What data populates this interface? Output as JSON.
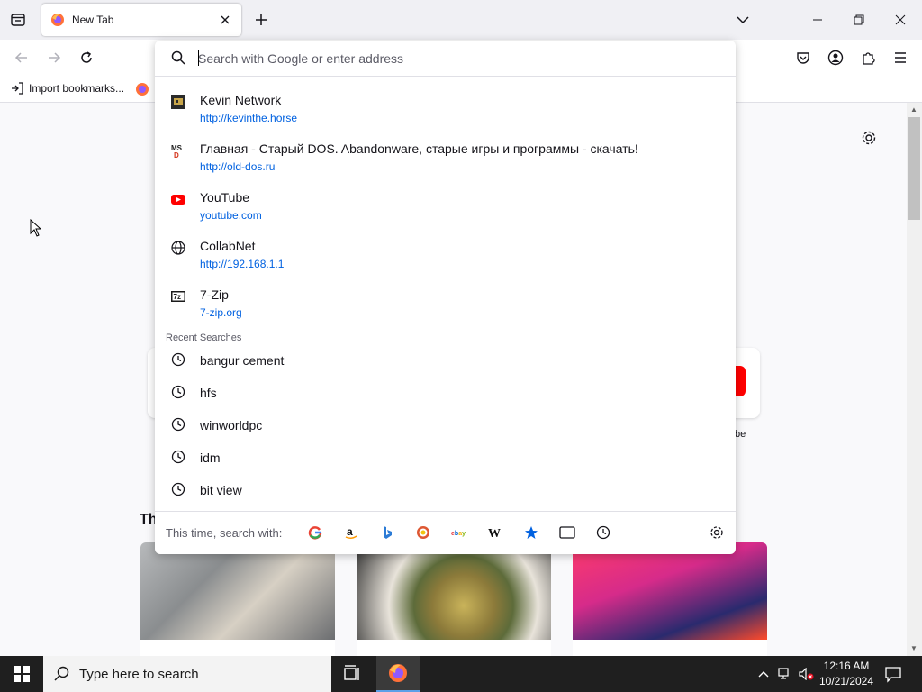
{
  "browser": {
    "tab": {
      "title": "New Tab"
    },
    "bookmarks_toolbar": {
      "import_label": "Import bookmarks..."
    }
  },
  "url_popup": {
    "placeholder": "Search with Google or enter address",
    "results": [
      {
        "title": "Kevin Network",
        "url": "http://kevinthe.horse",
        "icon": "kevin-network-favicon"
      },
      {
        "title": "Главная - Старый DOS. Abandonware, старые игры и программы - скачать!",
        "url": "http://old-dos.ru",
        "icon": "old-dos-favicon"
      },
      {
        "title": "YouTube",
        "url": "youtube.com",
        "icon": "youtube-favicon"
      },
      {
        "title": "CollabNet",
        "url": "http://192.168.1.1",
        "icon": "globe-icon"
      },
      {
        "title": "7-Zip",
        "url": "7-zip.org",
        "icon": "7zip-favicon"
      }
    ],
    "recent_label": "Recent Searches",
    "recent_searches": [
      "bangur cement",
      "hfs",
      "winworldpc",
      "idm",
      "bit view"
    ],
    "oneoff_label": "This time, search with:",
    "engines": [
      "Google",
      "Amazon",
      "Bing",
      "DuckDuckGo",
      "eBay",
      "Wikipedia",
      "Bookmarks",
      "Tabs",
      "History"
    ]
  },
  "content": {
    "partial_label": "be",
    "partial_heading": "Th"
  },
  "taskbar": {
    "search_placeholder": "Type here to search",
    "time": "12:16 AM",
    "date": "10/21/2024"
  },
  "colors": {
    "accent": "#0061e0",
    "youtube": "#ff0000"
  }
}
